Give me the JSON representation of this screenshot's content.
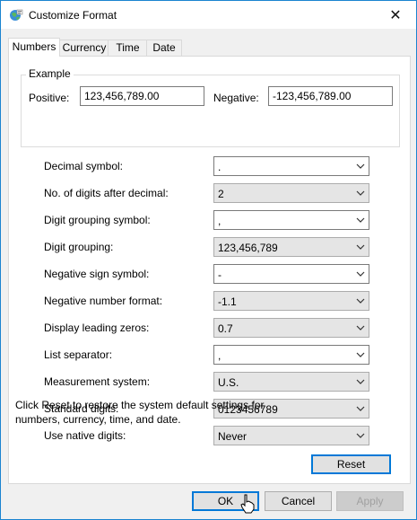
{
  "window": {
    "title": "Customize Format",
    "close_glyph": "✕"
  },
  "tabs": [
    {
      "label": "Numbers",
      "active": true
    },
    {
      "label": "Currency",
      "active": false
    },
    {
      "label": "Time",
      "active": false
    },
    {
      "label": "Date",
      "active": false
    }
  ],
  "example": {
    "title": "Example",
    "positive_label": "Positive:",
    "positive_value": "123,456,789.00",
    "negative_label": "Negative:",
    "negative_value": "-123,456,789.00"
  },
  "settings": [
    {
      "label": "Decimal symbol:",
      "value": ".",
      "editable": true
    },
    {
      "label": "No. of digits after decimal:",
      "value": "2",
      "editable": false
    },
    {
      "label": "Digit grouping symbol:",
      "value": ",",
      "editable": true
    },
    {
      "label": "Digit grouping:",
      "value": "123,456,789",
      "editable": false
    },
    {
      "label": "Negative sign symbol:",
      "value": "-",
      "editable": true
    },
    {
      "label": "Negative number format:",
      "value": "-1.1",
      "editable": false
    },
    {
      "label": "Display leading zeros:",
      "value": "0.7",
      "editable": false
    },
    {
      "label": "List separator:",
      "value": ",",
      "editable": true
    },
    {
      "label": "Measurement system:",
      "value": "U.S.",
      "editable": false
    },
    {
      "label": "Standard digits:",
      "value": "0123456789",
      "editable": false
    },
    {
      "label": "Use native digits:",
      "value": "Never",
      "editable": false
    }
  ],
  "reset": {
    "text": "Click Reset to restore the system default settings for numbers, currency, time, and date.",
    "button_label": "Reset"
  },
  "footer": {
    "ok_label": "OK",
    "cancel_label": "Cancel",
    "apply_label": "Apply"
  },
  "colors": {
    "accent": "#0078d7",
    "window_border": "#1a84d0"
  }
}
